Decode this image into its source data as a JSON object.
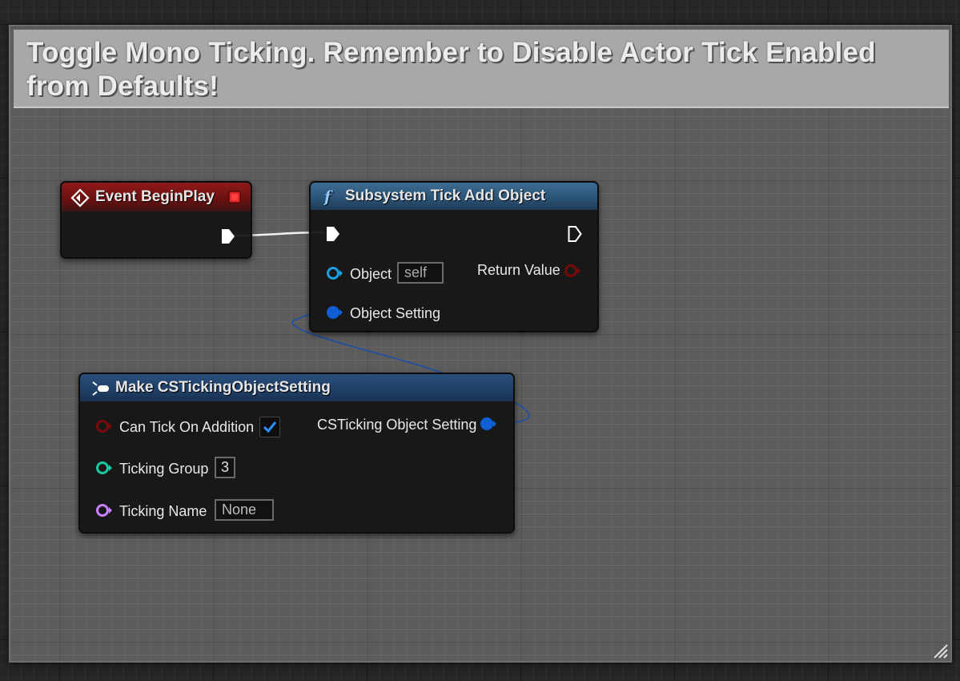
{
  "comment": {
    "title": "Toggle Mono Ticking. Remember to Disable Actor Tick Enabled from Defaults!"
  },
  "nodes": {
    "event_begin_play": {
      "title": "Event BeginPlay"
    },
    "subsystem_tick_add_object": {
      "title": "Subsystem Tick Add Object",
      "inputs": {
        "object_label": "Object",
        "object_value": "self",
        "object_setting_label": "Object Setting"
      },
      "outputs": {
        "return_value_label": "Return Value"
      }
    },
    "make_csticking_object_setting": {
      "title": "Make CSTickingObjectSetting",
      "inputs": {
        "can_tick_label": "Can Tick On Addition",
        "can_tick_checked": true,
        "ticking_group_label": "Ticking Group",
        "ticking_group_value": "3",
        "ticking_name_label": "Ticking Name",
        "ticking_name_value": "None"
      },
      "outputs": {
        "setting_label": "CSTicking Object Setting"
      }
    }
  },
  "colors": {
    "event_header": "#8e1a1a",
    "function_header": "#3e6c94",
    "struct_header": "#2a4f7a",
    "object_pin": "#1aa0e0",
    "struct_pin": "#0f5fd6",
    "bool_pin": "#7a0a0a",
    "int_pin": "#1ec8a0",
    "name_pin": "#c880ff",
    "exec_pin": "#ffffff",
    "stop_icon": "#e02828"
  },
  "icons": {
    "event": "diamond-event-icon",
    "function": "function-f-icon",
    "make_struct": "make-struct-icon",
    "stop": "stop-square-icon",
    "checkbox": "checkmark-icon"
  }
}
